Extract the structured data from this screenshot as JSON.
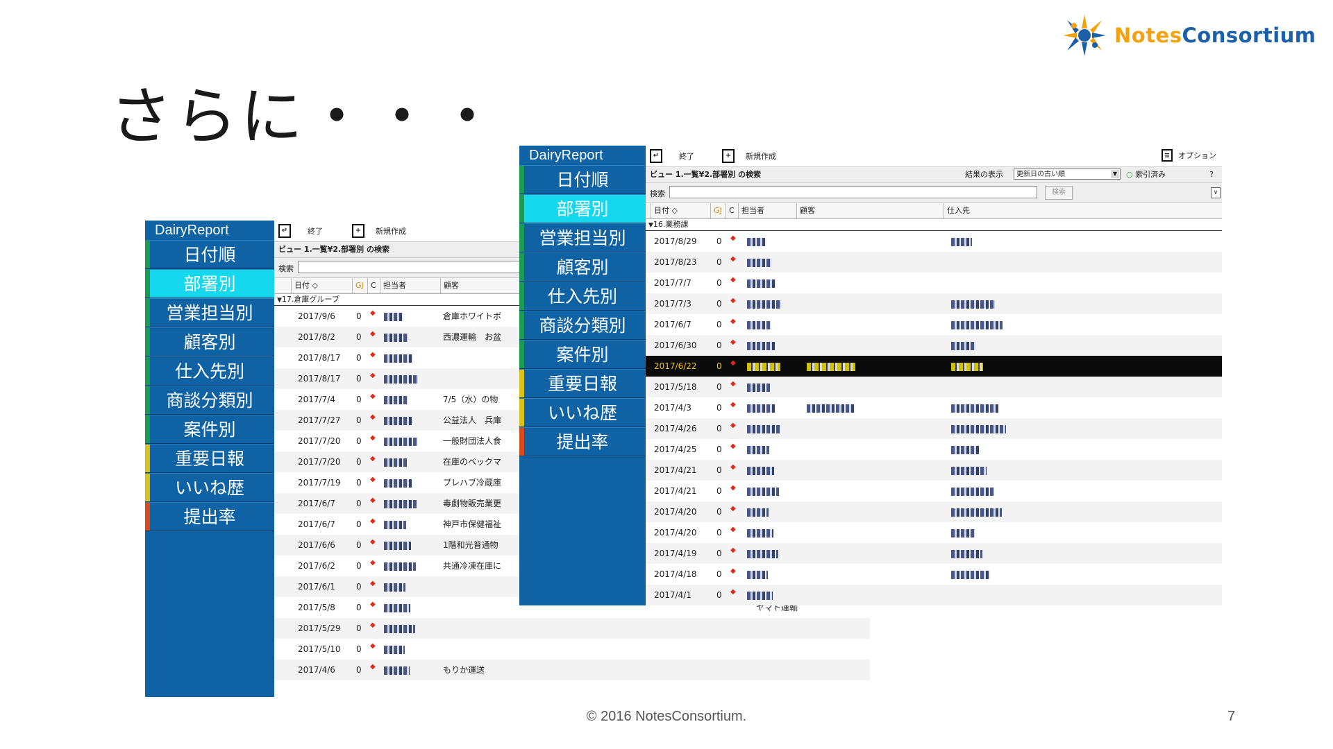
{
  "brand": {
    "logo_part1": "Notes",
    "logo_part2": "Consortium",
    "accent_orange": "#f2a30f",
    "accent_blue": "#1a5fa8"
  },
  "slide": {
    "title": "さらに・・・",
    "footer": "© 2016 NotesConsortium.",
    "page_number": "7"
  },
  "back_window": {
    "sidebar": {
      "title": "DairyReport",
      "items": [
        {
          "label": "日付順",
          "bar": "#1a9a55"
        },
        {
          "label": "部署別",
          "bar": "#1a9a55",
          "active": true
        },
        {
          "label": "営業担当別",
          "bar": "#1a9a55"
        },
        {
          "label": "顧客別",
          "bar": "#1a9a55"
        },
        {
          "label": "仕入先別",
          "bar": "#1a9a55"
        },
        {
          "label": "商談分類別",
          "bar": "#1a9a55"
        },
        {
          "label": "案件別",
          "bar": "#1a9a55"
        },
        {
          "label": "重要日報",
          "bar": "#d8c21a"
        },
        {
          "label": "いいね歴",
          "bar": "#d8c21a"
        },
        {
          "label": "提出率",
          "bar": "#d84a1a"
        }
      ]
    },
    "toolbar": {
      "exit": "終了",
      "new": "新規作成"
    },
    "view_title": "ビュー 1.一覧¥2.部署別 の検索",
    "search_label": "検索",
    "headers": {
      "date": "日付 ◇",
      "gj": "GJ",
      "c": "C",
      "person": "担当者",
      "customer": "顧客"
    },
    "category": "17.倉庫グループ",
    "rows": [
      {
        "date": "2017/9/6",
        "gj": "0",
        "customer": "倉庫ホワイトボ"
      },
      {
        "date": "2017/8/2",
        "gj": "0",
        "customer": "西濃運輸　お盆"
      },
      {
        "date": "2017/8/17",
        "gj": "0",
        "customer": ""
      },
      {
        "date": "2017/8/17",
        "gj": "0",
        "customer": ""
      },
      {
        "date": "2017/7/4",
        "gj": "0",
        "customer": "7/5（水）の物"
      },
      {
        "date": "2017/7/27",
        "gj": "0",
        "customer": "公益法人　兵庫"
      },
      {
        "date": "2017/7/20",
        "gj": "0",
        "customer": "一般財団法人食"
      },
      {
        "date": "2017/7/20",
        "gj": "0",
        "customer": "在庫のベックマ"
      },
      {
        "date": "2017/7/19",
        "gj": "0",
        "customer": "プレハブ冷蔵庫"
      },
      {
        "date": "2017/6/7",
        "gj": "0",
        "customer": "毒劇物販売業更"
      },
      {
        "date": "2017/6/7",
        "gj": "0",
        "customer": "神戸市保健福祉"
      },
      {
        "date": "2017/6/6",
        "gj": "0",
        "customer": "1階和光普通物"
      },
      {
        "date": "2017/6/2",
        "gj": "0",
        "customer": "共通冷凍在庫に"
      },
      {
        "date": "2017/6/1",
        "gj": "0",
        "customer": ""
      },
      {
        "date": "2017/5/8",
        "gj": "0",
        "customer": "",
        "supplier": "ヤマト運輸"
      },
      {
        "date": "2017/5/29",
        "gj": "0",
        "customer": ""
      },
      {
        "date": "2017/5/10",
        "gj": "0",
        "customer": ""
      },
      {
        "date": "2017/4/6",
        "gj": "0",
        "customer": "もりか運送"
      }
    ]
  },
  "front_window": {
    "sidebar": {
      "title": "DairyReport",
      "items": [
        {
          "label": "日付順",
          "bar": "#1a9a55"
        },
        {
          "label": "部署別",
          "bar": "#1a9a55",
          "active": true
        },
        {
          "label": "営業担当別",
          "bar": "#1a9a55"
        },
        {
          "label": "顧客別",
          "bar": "#1a9a55"
        },
        {
          "label": "仕入先別",
          "bar": "#1a9a55"
        },
        {
          "label": "商談分類別",
          "bar": "#1a9a55"
        },
        {
          "label": "案件別",
          "bar": "#1a9a55"
        },
        {
          "label": "重要日報",
          "bar": "#d8c21a"
        },
        {
          "label": "いいね歴",
          "bar": "#d8c21a"
        },
        {
          "label": "提出率",
          "bar": "#d84a1a"
        }
      ]
    },
    "toolbar": {
      "exit": "終了",
      "new": "新規作成",
      "options": "オプション"
    },
    "view_title": "ビュー 1.一覧¥2.部署別 の検索",
    "result_label": "結果の表示",
    "result_option": "更新日の古い順",
    "indexed": "索引済み",
    "help": "?",
    "search_label": "検索",
    "search_button": "検索",
    "headers": {
      "date": "日付 ◇",
      "gj": "GJ",
      "c": "C",
      "person": "担当者",
      "customer": "顧客",
      "supplier": "仕入先"
    },
    "category": "16.業務課",
    "rows": [
      {
        "date": "2017/8/29",
        "gj": "0"
      },
      {
        "date": "2017/8/23",
        "gj": "0"
      },
      {
        "date": "2017/7/7",
        "gj": "0"
      },
      {
        "date": "2017/7/3",
        "gj": "0"
      },
      {
        "date": "2017/6/7",
        "gj": "0"
      },
      {
        "date": "2017/6/30",
        "gj": "0"
      },
      {
        "date": "2017/6/22",
        "gj": "0",
        "highlight": true
      },
      {
        "date": "2017/5/18",
        "gj": "0"
      },
      {
        "date": "2017/4/3",
        "gj": "0"
      },
      {
        "date": "2017/4/26",
        "gj": "0"
      },
      {
        "date": "2017/4/25",
        "gj": "0"
      },
      {
        "date": "2017/4/21",
        "gj": "0"
      },
      {
        "date": "2017/4/21",
        "gj": "0"
      },
      {
        "date": "2017/4/20",
        "gj": "0"
      },
      {
        "date": "2017/4/20",
        "gj": "0"
      },
      {
        "date": "2017/4/19",
        "gj": "0"
      },
      {
        "date": "2017/4/18",
        "gj": "0"
      },
      {
        "date": "2017/4/1",
        "gj": "0"
      }
    ]
  }
}
